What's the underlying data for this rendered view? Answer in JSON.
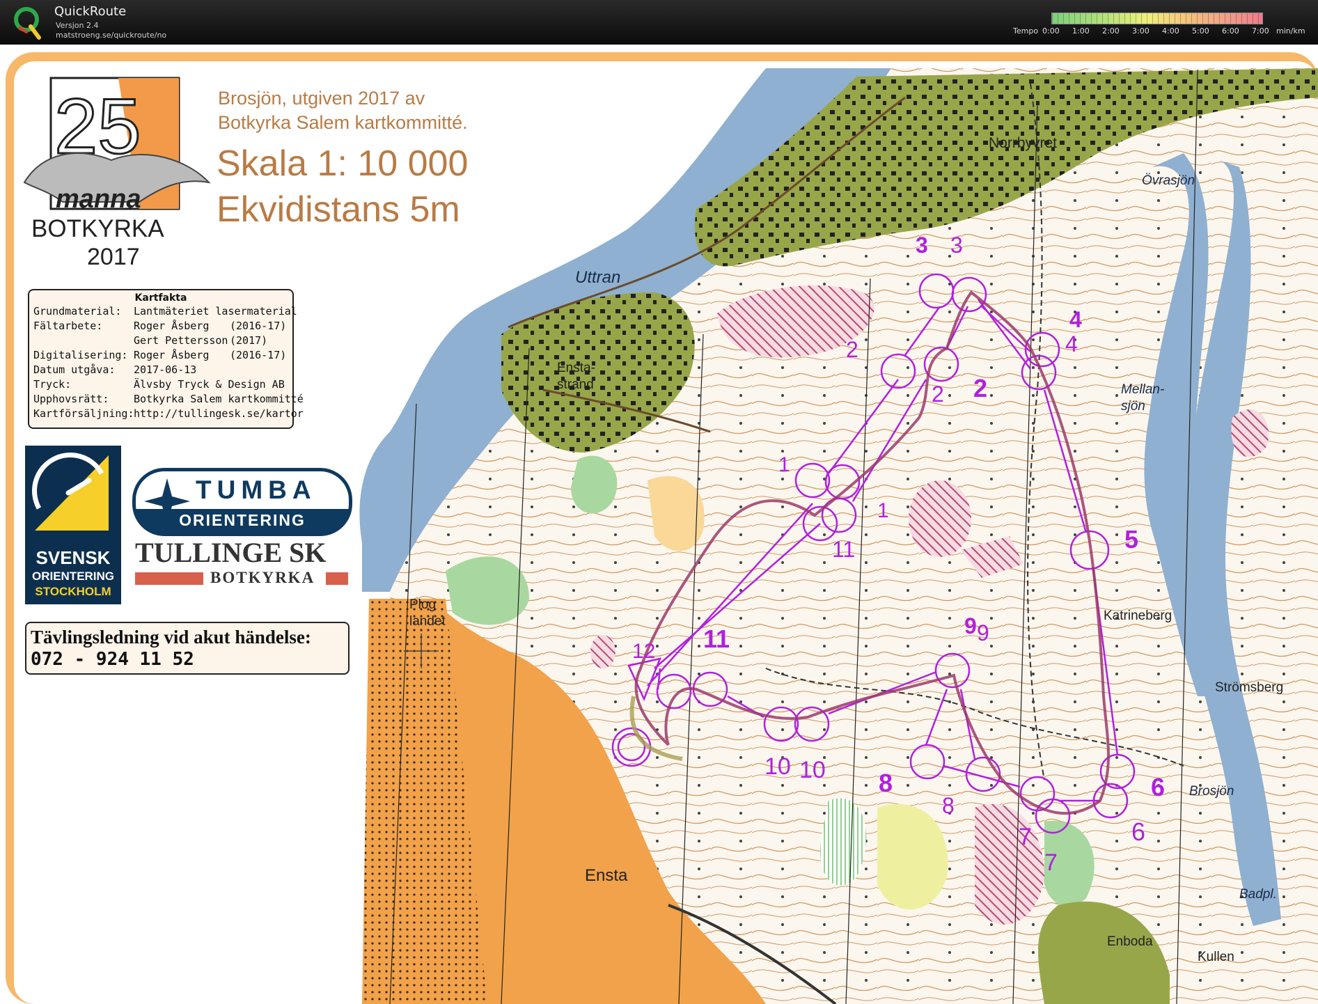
{
  "app": {
    "name": "QuickRoute",
    "version": "Versjon 2.4",
    "url": "matstroeng.se/quickroute/no"
  },
  "tempo_scale": {
    "label": "Tempo",
    "ticks": [
      "0:00",
      "1:00",
      "2:00",
      "3:00",
      "4:00",
      "5:00",
      "6:00",
      "7:00"
    ],
    "unit": "min/km"
  },
  "map_header": {
    "publisher_line1": "Brosjön, utgiven 2017 av",
    "publisher_line2": "Botkyrka Salem kartkommitté.",
    "scale": "Skala  1: 10 000",
    "contour": "Ekvidistans  5m"
  },
  "event_logo": {
    "number": "25",
    "name": "manna",
    "place": "BOTKYRKA",
    "year": "2017"
  },
  "kartfakta": {
    "title": "Kartfakta",
    "rows": [
      {
        "key": "Grundmaterial:",
        "value": "Lantmäteriet lasermaterial",
        "year": ""
      },
      {
        "key": "Fältarbete:",
        "value": "Roger Åsberg",
        "year": "(2016-17)"
      },
      {
        "key": "",
        "value": "Gert Pettersson",
        "year": "(2017)"
      },
      {
        "key": "Digitalisering:",
        "value": "Roger Åsberg",
        "year": "(2016-17)"
      },
      {
        "key": "Datum utgåva:",
        "value": "2017-06-13",
        "year": ""
      },
      {
        "key": "Tryck:",
        "value": "Älvsby Tryck & Design AB",
        "year": ""
      },
      {
        "key": "Upphovsrätt:",
        "value": "Botkyrka Salem kartkommitté",
        "year": ""
      },
      {
        "key": "Kartförsäljning:",
        "value": "http://tullingesk.se/kartor",
        "year": ""
      }
    ]
  },
  "sponsors": {
    "svensk_1": "SVENSK",
    "svensk_2": "ORIENTERING",
    "svensk_3": "STOCKHOLM",
    "tumba_1": "TUMBA",
    "tumba_2": "ORIENTERING",
    "tullinge_1": "TULLINGE SK",
    "tullinge_2": "BOTKYRKA"
  },
  "emergency": {
    "title": "Tävlingsledning vid akut händelse:",
    "phone": "072 - 924 11 52"
  },
  "place_names": {
    "norrbyvret": "Norrbyvret",
    "ovrasjon": "Övrasjön",
    "uttran": "Uttran",
    "ensta_strand_1": "Ensta-",
    "ensta_strand_2": "strand",
    "mellansjon_1": "Mellan-",
    "mellansjon_2": "sjön",
    "katrineberg": "Katrineberg",
    "stromsberg": "Strömsberg",
    "brosjon": "Brosjön",
    "badpl": "Badpl.",
    "enboda": "Enboda",
    "kullen": "Kullen",
    "ensta": "Ensta",
    "plog_1": "Plog",
    "plog_2": "landet"
  },
  "controls": {
    "c1a": "1",
    "c1b": "1",
    "c2a": "2",
    "c2b": "2",
    "c2c": "2",
    "c3a": "3",
    "c3b": "3",
    "c4a": "4",
    "c4b": "4",
    "c5": "5",
    "c6a": "6",
    "c6b": "6",
    "c7a": "7",
    "c7b": "7",
    "c8a": "8",
    "c8b": "8",
    "c9a": "9",
    "c9b": "9",
    "c10a": "10",
    "c10b": "10",
    "c11a": "11",
    "c11b": "11",
    "c12": "12"
  },
  "colors": {
    "course": "#b020e0",
    "route": "#9a3a6a",
    "water": "#8fb0d0",
    "open_land": "#f2a24a",
    "settlement": "#98a64a",
    "frame": "#f7b86a",
    "header_text": "#b87b45"
  }
}
